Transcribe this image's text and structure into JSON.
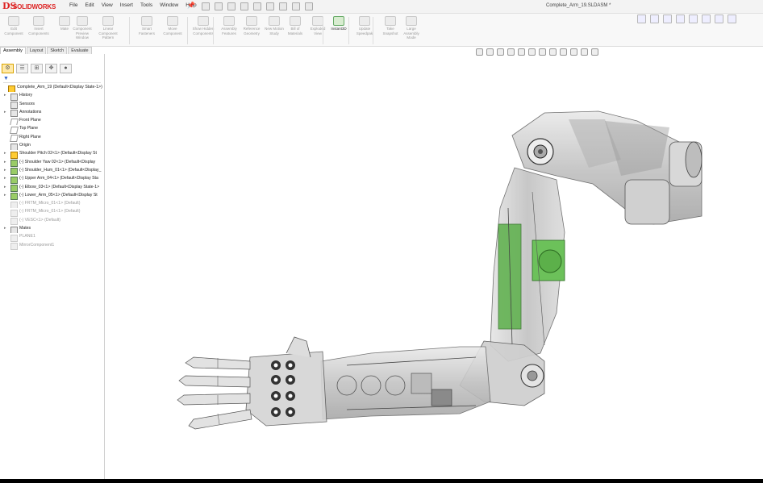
{
  "app": {
    "brand": "SOLIDWORKS",
    "logo_glyph": "DS",
    "document_title": "Complete_Arm_19.SLDASM *"
  },
  "menu": [
    "File",
    "Edit",
    "View",
    "Insert",
    "Tools",
    "Window",
    "Help"
  ],
  "command_manager": [
    {
      "label": "Edit Component"
    },
    {
      "label": "Insert Components"
    },
    {
      "label": "Mate"
    },
    {
      "label": "Component Preview Window"
    },
    {
      "label": "Linear Component Pattern"
    },
    {
      "label": "Smart Fasteners"
    },
    {
      "label": "Move Component"
    },
    {
      "label": "Show Hidden Components"
    },
    {
      "label": "Assembly Features"
    },
    {
      "label": "Reference Geometry"
    },
    {
      "label": "New Motion Study"
    },
    {
      "label": "Bill of Materials"
    },
    {
      "label": "Exploded View"
    },
    {
      "label": "Instant3D",
      "active": true
    },
    {
      "label": "Update Speedpak"
    },
    {
      "label": "Take Snapshot"
    },
    {
      "label": "Large Assembly Mode"
    }
  ],
  "panel_tabs": [
    "Assembly",
    "Layout",
    "Sketch",
    "Evaluate"
  ],
  "tree": [
    {
      "text": "Complete_Arm_19 (Default<Display State-1>)",
      "icon": "asm",
      "indent": 0,
      "expander": ""
    },
    {
      "text": "History",
      "icon": "folder",
      "indent": 1,
      "expander": "▸"
    },
    {
      "text": "Sensors",
      "icon": "folder",
      "indent": 1,
      "expander": ""
    },
    {
      "text": "Annotations",
      "icon": "folder",
      "indent": 1,
      "expander": "▸"
    },
    {
      "text": "Front Plane",
      "icon": "plane",
      "indent": 1,
      "expander": ""
    },
    {
      "text": "Top Plane",
      "icon": "plane",
      "indent": 1,
      "expander": ""
    },
    {
      "text": "Right Plane",
      "icon": "plane",
      "indent": 1,
      "expander": ""
    },
    {
      "text": "Origin",
      "icon": "origin",
      "indent": 1,
      "expander": ""
    },
    {
      "text": "Shoulder Pitch 02<1> (Default<Display St",
      "icon": "asm",
      "indent": 1,
      "expander": "▸"
    },
    {
      "text": "(-) Shoulder Yaw 02<1> (Default<Display",
      "icon": "comp",
      "indent": 1,
      "expander": "▸"
    },
    {
      "text": "(-) Shoulder_Hum_01<1> (Default<Display_",
      "icon": "comp",
      "indent": 1,
      "expander": "▸"
    },
    {
      "text": "(-) Upper Arm_04<1> (Default<Display Sta",
      "icon": "comp",
      "indent": 1,
      "expander": "▸"
    },
    {
      "text": "(-) Elbow_03<1> (Default<Display State-1>",
      "icon": "comp",
      "indent": 1,
      "expander": "▸"
    },
    {
      "text": "(-) Lower_Arm_05<1> (Default<Display St",
      "icon": "comp",
      "indent": 1,
      "expander": "▸"
    },
    {
      "text": "(-) FRTM_Micro_01<1> (Default)",
      "icon": "sup",
      "indent": 1,
      "expander": "",
      "dim": true
    },
    {
      "text": "(-) FRTM_Micro_01<1> (Default)",
      "icon": "sup",
      "indent": 1,
      "expander": "",
      "dim": true
    },
    {
      "text": "(-) VESC<1> (Default)",
      "icon": "sup",
      "indent": 1,
      "expander": "",
      "dim": true
    },
    {
      "text": "Mates",
      "icon": "folder",
      "indent": 1,
      "expander": "▸"
    },
    {
      "text": "PLANE1",
      "icon": "sup",
      "indent": 1,
      "expander": "",
      "dim": true
    },
    {
      "text": "MirrorComponent1",
      "icon": "sup",
      "indent": 1,
      "expander": "",
      "dim": true
    }
  ],
  "colors": {
    "accent_green": "#5cb04a",
    "brand_red": "#d22222",
    "selection": "#ffe9a8"
  }
}
